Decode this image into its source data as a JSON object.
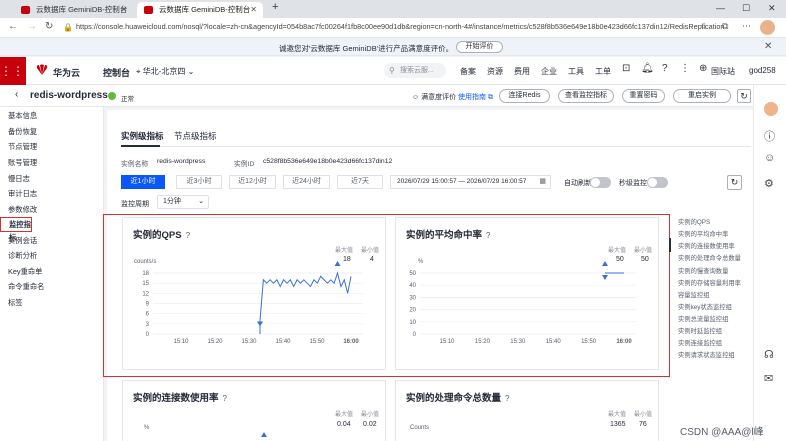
{
  "browser": {
    "tabs": [
      {
        "title": "云数据库 GeminiDB-控制台",
        "active": false
      },
      {
        "title": "云数据库 GeminiDB-控制台",
        "active": true
      }
    ],
    "new_tab": "+",
    "url": "https://console.huaweicloud.com/nosql/?locale=zh-cn&agencyId=054b8ac7fc00264f1fb8c00ee90d1db&region=cn-north-4#/instance/metrics/c528f8b536e649e18b0e423d66fc137din12/RedisReplication"
  },
  "notice": {
    "text": "诚邀您对'云数据库 GeminiDB'进行产品满意度评价。",
    "button": "开始评价"
  },
  "topnav": {
    "brand": "华为云",
    "console": "控制台",
    "region": "华北-北京四",
    "search_placeholder": "搜索云服...",
    "menu": [
      "备案",
      "资源",
      "费用",
      "企业",
      "工具",
      "工单"
    ],
    "lang": "国际站",
    "user": "god258"
  },
  "pagehead": {
    "instance_name": "redis-wordpress",
    "status": "正常",
    "survey": "满意度评价",
    "guide": "使用指南",
    "buttons": [
      "连接Redis",
      "查看监控指标",
      "重置密码",
      "重启实例"
    ]
  },
  "sidebar": {
    "items": [
      "基本信息",
      "备份恢复",
      "节点管理",
      "账号管理",
      "慢日志",
      "审计日志",
      "参数修改",
      "监控指标",
      "实例会话",
      "诊断分析",
      "Key重命单",
      "命令重命名",
      "标签"
    ],
    "active_index": 7
  },
  "main": {
    "tabs": [
      "实例级指标",
      "节点级指标"
    ],
    "info": {
      "name_label": "实例名称",
      "name_value": "redis-wordpress",
      "id_label": "实例ID",
      "id_value": "c528f8b536e649e18b0e423d66fc137din12"
    },
    "time_ranges": [
      "近1小时",
      "近3小时",
      "近12小时",
      "近24小时",
      "近7天"
    ],
    "selected_range": 0,
    "date_range": "2026/07/29 15:00:57 — 2026/07/29 16:00:57",
    "auto_refresh": "自动刷新",
    "second_monitor": "秒级监控",
    "period_label": "监控周期",
    "period_value": "1分钟"
  },
  "charts": {
    "qps": {
      "title": "实例的QPS",
      "max_label": "最大值",
      "min_label": "最小值",
      "max": "18",
      "min": "4",
      "unit": "counts/s"
    },
    "hit_rate": {
      "title": "实例的平均命中率",
      "max_label": "最大值",
      "min_label": "最小值",
      "max": "50",
      "min": "50",
      "unit": "%"
    },
    "conn_usage": {
      "title": "实例的连接数使用率",
      "max_label": "最大值",
      "min_label": "最小值",
      "max": "0.04",
      "min": "0.02",
      "unit": "%"
    },
    "cmd_total": {
      "title": "实例的处理命令总数量",
      "max_label": "最大值",
      "min_label": "最小值",
      "max": "1365",
      "min": "76",
      "unit": "Counts"
    }
  },
  "chart_data": [
    {
      "type": "line",
      "title": "实例的QPS",
      "ylabel": "counts/s",
      "y_ticks": [
        0,
        3,
        6,
        9,
        12,
        15,
        18
      ],
      "x_ticks": [
        "15:10",
        "15:20",
        "15:30",
        "15:40",
        "15:50",
        "16:00"
      ],
      "ylim": [
        0,
        18
      ],
      "series": [
        {
          "values": [
            4,
            16,
            15,
            16,
            15,
            16,
            14,
            16,
            15,
            16,
            14,
            16,
            15,
            16,
            15,
            14,
            16,
            15,
            17,
            16,
            15,
            16,
            15,
            18,
            14,
            16,
            12,
            17
          ]
        }
      ]
    },
    {
      "type": "line",
      "title": "实例的平均命中率",
      "ylabel": "%",
      "y_ticks": [
        0,
        10,
        20,
        30,
        40,
        50
      ],
      "x_ticks": [
        "15:10",
        "15:20",
        "15:30",
        "15:40",
        "15:50",
        "16:00"
      ],
      "ylim": [
        0,
        50
      ],
      "series": [
        {
          "values": [
            50,
            50,
            50,
            50,
            50
          ]
        }
      ]
    }
  ],
  "right_nav": [
    "实例的QPS",
    "实例的平均命中率",
    "实例的连接数使用率",
    "实例的处理命令总数量",
    "实例的慢查询数量",
    "实例的存储容量利用率",
    "容量监控组",
    "实例key状态监控组",
    "实例总流量监控组",
    "实例时延监控组",
    "实例连接监控组",
    "实例请求状态监控组"
  ],
  "watermark": "CSDN @AAA@l峰"
}
